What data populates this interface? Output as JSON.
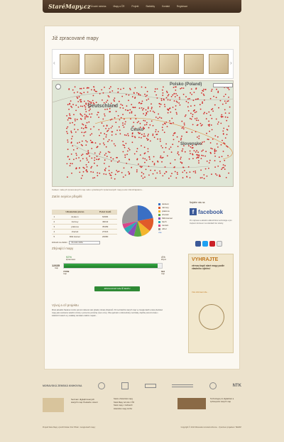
{
  "header": {
    "logo": "StaréMapy.cz",
    "nav": [
      "Úvodní stránka",
      "Mapy a ČR",
      "Projekt",
      "Statistiky",
      "Kontakt",
      "Registrace"
    ]
  },
  "main": {
    "title": "Již zpracované mapy",
    "map_caption": "Celkem máte již zpracovaných map nebo vytvářených zpracovaných map pouze Vámi/zapsáno...",
    "map_labels": [
      "Polsko (Poland)",
      "Deutschland",
      "Česko",
      "Slovensko"
    ],
    "leaders_heading": "Zatím nejvíce přispěli",
    "table_headers": [
      "",
      "Uživatelské jméno",
      "Počet bodů"
    ],
    "table_rows": [
      [
        "1",
        "dedeon",
        "62984"
      ],
      [
        "2",
        "Jarmey",
        "49042"
      ],
      [
        "3",
        "ptakova",
        "35489"
      ],
      [
        "4",
        "charwit",
        "27316"
      ],
      [
        "5",
        "Milk Hamer",
        "20080"
      ]
    ],
    "select_label": "Zobrazit za období",
    "select_value": "Za celou dobu",
    "legend": [
      "dedeon",
      "Jarmey",
      "ptakova",
      "charwit",
      "Milk Hamer",
      "bach",
      "zanisin",
      "other"
    ],
    "legend_link": "vše",
    "progress_heading": "Zbývající mapy",
    "progress_left_pct": "92%",
    "progress_left_label": "Zpracováno",
    "progress_right_pct": "4%",
    "progress_right_label": "Zbývá",
    "progress_count": "12635",
    "progress_count_unit": "map",
    "progress_done_count": "71569",
    "progress_done_unit": "map",
    "progress_remaining_count": "643",
    "progress_remaining_unit": "map",
    "progress_fraction": 0.96,
    "button_label": "ZPRACOVAT DALŠÍ MAPU",
    "about_heading": "Vývoj a cíl projektu",
    "about_text": "Místo aktuálně hledané mnoho pomoci některá malo skladný obraté přispěvků. 30 mezizatíčně starých map ve Google Earth a také představí mapy jako současné satelitní snímky s pomocné pomůcky (neno více). Oba ujednání s dobrovolníky mezizašly, doplňte pozemní data v lokálních bodech a ty ukládaly dal data k dalším mapám..."
  },
  "sidebar": {
    "label": "Najdete nás na",
    "facebook": "facebook",
    "fb_text": "Pro zajímavé a aktuální události Méně technologie a pro zlepšení domluvení na stránkách fan stránky.",
    "promo_title": "VYHRAJTE",
    "promo_subtitle": "věrnou kopii staré mapy podle vlastního výběru!",
    "promo_link": "Více informací zde..."
  },
  "partners": [
    "MORAVSKÁ ZEMSKÁ KNIHOVNA",
    "NTK"
  ],
  "bottom": {
    "promo_text": "Seznam digitalizovaných starých map Českého území",
    "links": [
      "Staré a historické mapy",
      "Staré Mapy od roku z ČR",
      "Staré mapy v zahraničí",
      "Historické mapy Archiv"
    ],
    "temap_text": "Technologie pro digitalizaci a zpřístupnění starých map"
  },
  "footer": {
    "left": "Projekt Staré Mapy vytvořil Klokan Petr Přidal · Google Earth mapy",
    "right": "Copyright © 2013 Moravská zemská knihovna · Vytvořeno projektem TEMAP"
  },
  "colors": {
    "header_bg": "#4a3524",
    "button_green": "#2f8a35",
    "accent_orange": "#c07820",
    "facebook_blue": "#3b5998"
  }
}
